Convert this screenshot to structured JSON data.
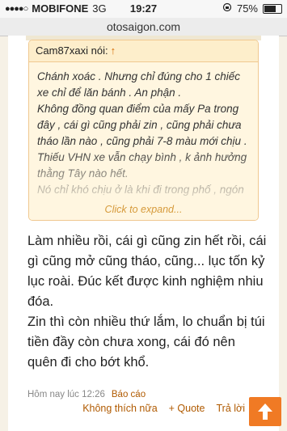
{
  "status_bar": {
    "signal_dots": "●●●●○",
    "carrier": "MOBIFONE",
    "network": "3G",
    "time": "19:27",
    "battery_percent_label": "75%",
    "battery_level": 0.75
  },
  "browser": {
    "url": "otosaigon.com"
  },
  "quote": {
    "author_label": "Cam87xaxi nói:",
    "arrow": "↑",
    "text": "Chánh xoác . Nhưng chỉ đúng cho 1 chiếc xe chỉ để lăn bánh . An phận .\nKhông đồng quan điểm của mấy Pa trong đây , cái gì cũng phải zin , cũng phải chưa tháo lần nào , cũng phải 7-8 màu mới chịu .\nThiếu VHN xe vẫn chạy bình , k ảnh hưởng thằng Tây nào hết.\nNó chỉ khó chịu ở là khi đi trong phố , ngón",
    "expand_label": "Click to expand..."
  },
  "post": {
    "body": "Làm nhiều rồi, cái gì cũng zin hết rồi, cái gì cũng mở cũng tháo, cũng... lục tốn kỷ lục roài. Đúc kết được kinh nghiệm nhiu đóa.\nZin thì còn nhiều thứ lắm, lo chuẩn bị túi tiền đầy còn chưa xong, cái đó nên quên đi cho bớt khổ.",
    "timestamp": "Hôm nay lúc 12:26",
    "report_label": "Báo cáo",
    "unlike_label": "Không thích nữa",
    "quote_label": "+ Quote",
    "reply_label": "Trả lời"
  },
  "colors": {
    "accent": "#f07a24",
    "link": "#b05a00",
    "quote_bg": "#fff6e0"
  }
}
